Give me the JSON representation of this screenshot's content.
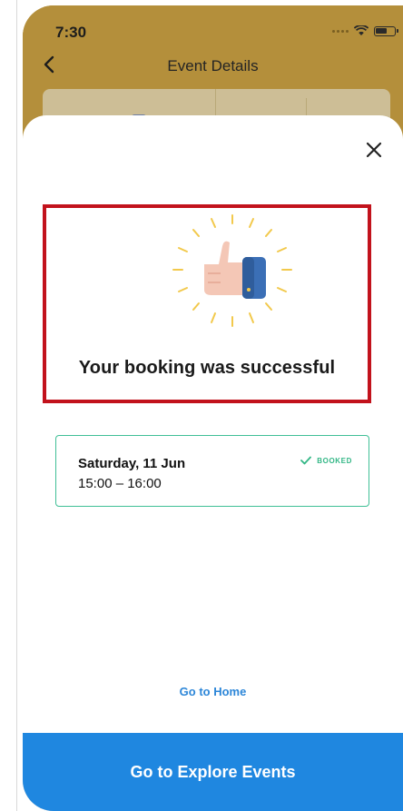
{
  "status_bar": {
    "time": "7:30",
    "icons": [
      "signal-icon",
      "wifi-icon",
      "battery-icon"
    ]
  },
  "nav": {
    "title": "Event Details",
    "back_icon": "chevron-left-icon"
  },
  "modal": {
    "close_icon": "close-icon",
    "illustration": "thumbs-up-illustration",
    "heading": "Your booking was successful",
    "booking": {
      "date": "Saturday, 11 Jun",
      "time": "15:00 – 16:00",
      "status": "BOOKED",
      "status_icon": "check-icon"
    },
    "home_link": "Go to Home",
    "primary_button": "Go to Explore Events"
  },
  "colors": {
    "header": "#b48f3b",
    "accent_blue": "#1f87e0",
    "link_blue": "#2c86d8",
    "success_green": "#33b786",
    "highlight_red": "#c2121c"
  }
}
